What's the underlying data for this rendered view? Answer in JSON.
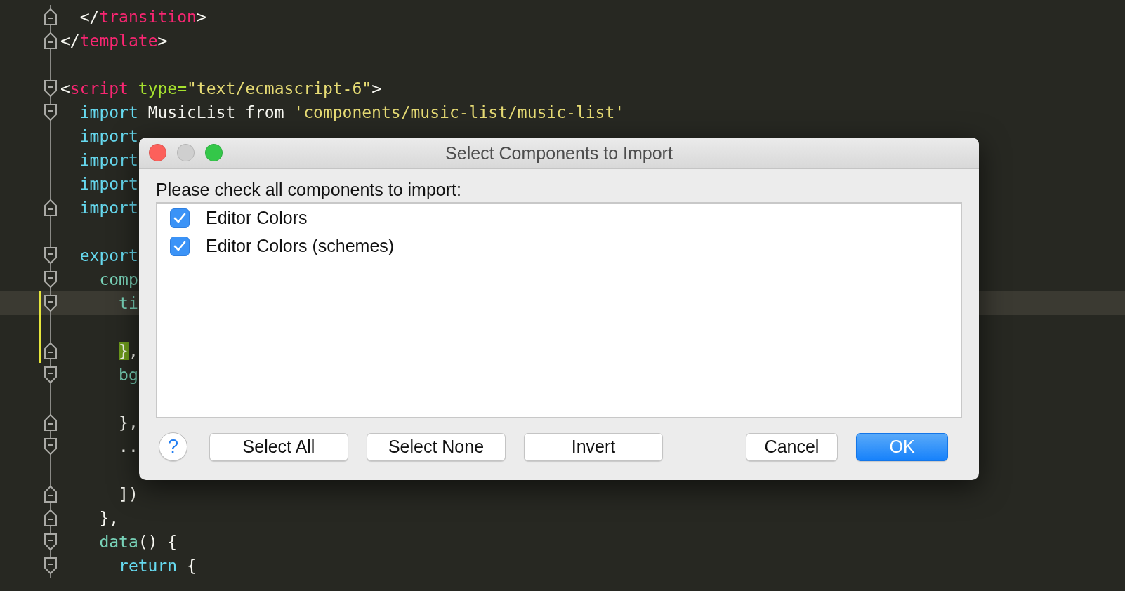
{
  "editor": {
    "lines": [
      {
        "tokens": [
          {
            "kind": "tag",
            "text": "  </"
          },
          {
            "kind": "tagname",
            "text": "transition"
          },
          {
            "kind": "tag",
            "text": ">"
          }
        ],
        "fold_marker": {
          "kind": "end"
        }
      },
      {
        "tokens": [
          {
            "kind": "tag",
            "text": "</"
          },
          {
            "kind": "tagname",
            "text": "template"
          },
          {
            "kind": "tag",
            "text": ">"
          }
        ],
        "fold_marker": {
          "kind": "end"
        }
      },
      {
        "kind": "blank"
      },
      {
        "tokens": [
          {
            "kind": "tag",
            "text": "<"
          },
          {
            "kind": "tagname",
            "text": "script"
          },
          {
            "kind": "attr",
            "text": " type="
          },
          {
            "kind": "string",
            "text": "\"text/ecmascript-6\""
          },
          {
            "kind": "tag",
            "text": ">"
          }
        ],
        "fold_marker": {
          "kind": "start"
        }
      },
      {
        "tokens": [
          {
            "kind": "keyword",
            "text": "  import"
          },
          {
            "kind": "plain",
            "text": " MusicList from "
          },
          {
            "kind": "string",
            "text": "'components/music-list/music-list'"
          }
        ],
        "fold_marker": {
          "kind": "start"
        }
      },
      {
        "tokens": [
          {
            "kind": "keyword",
            "text": "  import"
          }
        ]
      },
      {
        "tokens": [
          {
            "kind": "keyword",
            "text": "  import"
          }
        ]
      },
      {
        "tokens": [
          {
            "kind": "keyword",
            "text": "  import"
          }
        ]
      },
      {
        "tokens": [
          {
            "kind": "keyword",
            "text": "  import"
          }
        ],
        "fold_marker": {
          "kind": "end"
        }
      },
      {
        "kind": "blank"
      },
      {
        "tokens": [
          {
            "kind": "keyword",
            "text": "  export"
          }
        ],
        "fold_marker": {
          "kind": "start"
        }
      },
      {
        "tokens": [
          {
            "kind": "property",
            "text": "    comp"
          }
        ],
        "fold_marker": {
          "kind": "start"
        }
      },
      {
        "tokens": [
          {
            "kind": "property",
            "text": "      ti"
          }
        ],
        "fold_marker": {
          "kind": "start"
        },
        "current": true,
        "changed": true
      },
      {
        "kind": "blank",
        "changed": true
      },
      {
        "tokens": [
          {
            "kind": "match",
            "text": "      }"
          },
          {
            "kind": "plain",
            "text": ","
          }
        ],
        "fold_marker": {
          "kind": "end"
        },
        "changed": true
      },
      {
        "tokens": [
          {
            "kind": "property",
            "text": "      bg"
          }
        ],
        "fold_marker": {
          "kind": "start"
        }
      },
      {
        "kind": "blank"
      },
      {
        "tokens": [
          {
            "kind": "plain",
            "text": "      },"
          }
        ],
        "fold_marker": {
          "kind": "end"
        }
      },
      {
        "tokens": [
          {
            "kind": "plain",
            "text": "      .."
          }
        ],
        "fold_marker": {
          "kind": "start"
        }
      },
      {
        "kind": "blank"
      },
      {
        "tokens": [
          {
            "kind": "plain",
            "text": "      ])"
          }
        ],
        "fold_marker": {
          "kind": "end"
        }
      },
      {
        "tokens": [
          {
            "kind": "plain",
            "text": "    },"
          }
        ],
        "fold_marker": {
          "kind": "end"
        }
      },
      {
        "tokens": [
          {
            "kind": "property",
            "text": "    data"
          },
          {
            "kind": "plain",
            "text": "() {"
          }
        ],
        "fold_marker": {
          "kind": "start"
        }
      },
      {
        "tokens": [
          {
            "kind": "keyword",
            "text": "      return"
          },
          {
            "kind": "plain",
            "text": " {"
          }
        ],
        "fold_marker": {
          "kind": "start"
        }
      }
    ]
  },
  "dialog": {
    "title": "Select Components to Import",
    "window_controls": [
      {
        "color": "#fc605b"
      },
      {
        "color": "#cfcfcf"
      },
      {
        "color": "#34c749"
      }
    ],
    "prompt": "Please check all components to import:",
    "items": [
      {
        "label": "Editor Colors",
        "checked": true
      },
      {
        "label": "Editor Colors (schemes)",
        "checked": true
      }
    ],
    "help": "?",
    "buttons": [
      {
        "label": "Select All",
        "kind": "normal"
      },
      {
        "label": "Select None",
        "kind": "normal"
      },
      {
        "label": "Invert",
        "kind": "normal"
      },
      {
        "label": "Cancel",
        "kind": "normal"
      },
      {
        "label": "OK",
        "kind": "default"
      }
    ]
  }
}
